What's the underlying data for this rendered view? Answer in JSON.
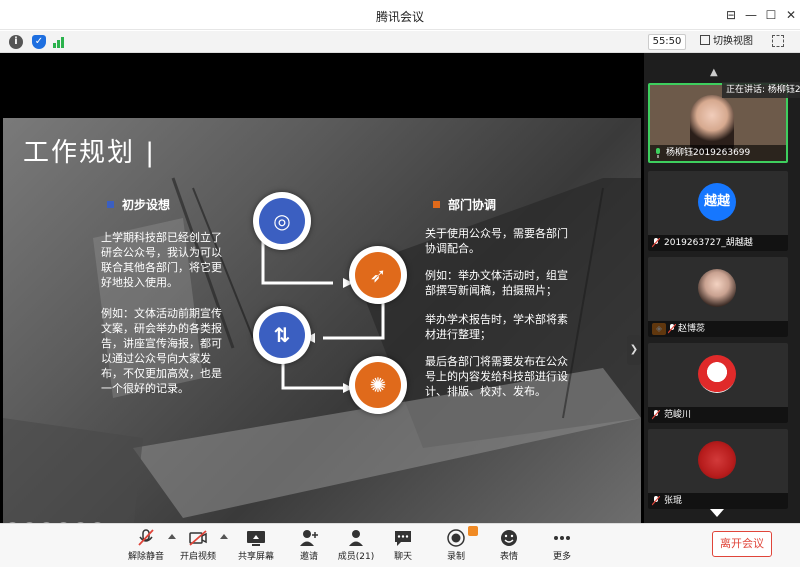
{
  "window": {
    "title": "腾讯会议"
  },
  "infobar": {
    "timer": "55:50",
    "view_switch_label": "切换视图"
  },
  "slide": {
    "title": "工作规划 |",
    "left_section": {
      "heading": "初步设想",
      "paragraphs": [
        "上学期科技部已经创立了研会公众号，我认为可以联合其他各部门，将它更好地投入使用。",
        "例如：文体活动前期宣传文案，研会举办的各类报告，讲座宣传海报，都可以通过公众号向大家发布，不仅更加高效，也是一个很好的记录。"
      ]
    },
    "right_section": {
      "heading": "部门协调",
      "paragraphs": [
        "关于使用公众号，需要各部门协调配合。",
        "例如：举办文体活动时，组宣部撰写新闻稿，拍摄照片；",
        "举办学术报告时，学术部将素材进行整理；",
        "最后各部门将需要发布在公众号上的内容发给科技部进行设计、排版、校对、发布。"
      ]
    },
    "colors": {
      "blue": "#3b5fc1",
      "orange": "#e06a1b"
    }
  },
  "panel": {
    "speaking_label": "正在讲话: 杨柳钰2",
    "participants": [
      {
        "name": "杨柳钰2019263699",
        "avatar_text": ""
      },
      {
        "name": "2019263727_胡越越",
        "avatar_text": "越越"
      },
      {
        "name": "赵博蕊",
        "avatar_text": ""
      },
      {
        "name": "范峻川",
        "avatar_text": ""
      },
      {
        "name": "张琨",
        "avatar_text": ""
      }
    ]
  },
  "toolbar": {
    "mute_label": "解除静音",
    "video_label": "开启视频",
    "share_label": "共享屏幕",
    "invite_label": "邀请",
    "members_label": "成员(21)",
    "chat_label": "聊天",
    "record_label": "录制",
    "reaction_label": "表情",
    "more_label": "更多",
    "leave_label": "离开会议"
  }
}
